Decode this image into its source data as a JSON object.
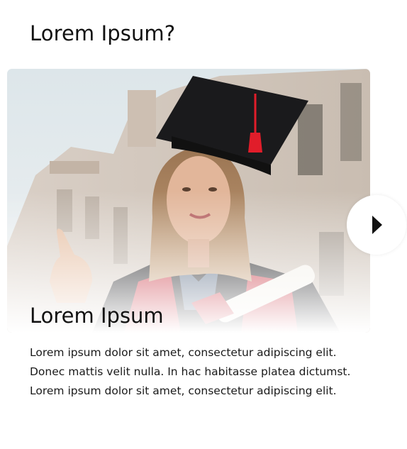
{
  "section": {
    "title": "Lorem Ipsum?"
  },
  "card": {
    "image_alt": "Graduate student in cap and gown pointing, holding a diploma",
    "title": "Lorem Ipsum",
    "text": "Lorem ipsum dolor sit amet, consectetur adipiscing elit. Donec mattis velit nulla. In hac habitasse platea dictumst. Lorem ipsum dolor sit amet, consectetur adipiscing elit."
  },
  "carousel": {
    "next_icon": "chevron-right-icon"
  },
  "colors": {
    "text": "#111111",
    "background": "#ffffff"
  }
}
